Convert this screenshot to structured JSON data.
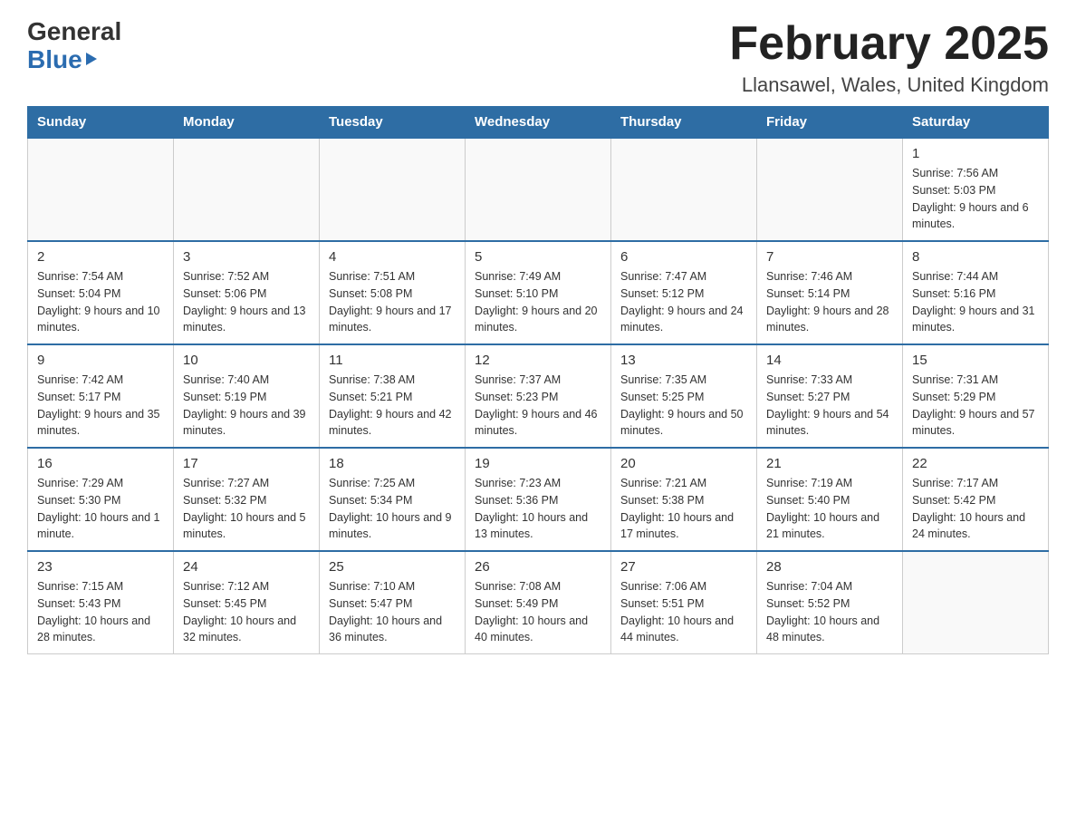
{
  "header": {
    "logo_general": "General",
    "logo_blue": "Blue",
    "month_title": "February 2025",
    "location": "Llansawel, Wales, United Kingdom"
  },
  "weekdays": [
    "Sunday",
    "Monday",
    "Tuesday",
    "Wednesday",
    "Thursday",
    "Friday",
    "Saturday"
  ],
  "weeks": [
    [
      {
        "day": "",
        "info": ""
      },
      {
        "day": "",
        "info": ""
      },
      {
        "day": "",
        "info": ""
      },
      {
        "day": "",
        "info": ""
      },
      {
        "day": "",
        "info": ""
      },
      {
        "day": "",
        "info": ""
      },
      {
        "day": "1",
        "info": "Sunrise: 7:56 AM\nSunset: 5:03 PM\nDaylight: 9 hours and 6 minutes."
      }
    ],
    [
      {
        "day": "2",
        "info": "Sunrise: 7:54 AM\nSunset: 5:04 PM\nDaylight: 9 hours and 10 minutes."
      },
      {
        "day": "3",
        "info": "Sunrise: 7:52 AM\nSunset: 5:06 PM\nDaylight: 9 hours and 13 minutes."
      },
      {
        "day": "4",
        "info": "Sunrise: 7:51 AM\nSunset: 5:08 PM\nDaylight: 9 hours and 17 minutes."
      },
      {
        "day": "5",
        "info": "Sunrise: 7:49 AM\nSunset: 5:10 PM\nDaylight: 9 hours and 20 minutes."
      },
      {
        "day": "6",
        "info": "Sunrise: 7:47 AM\nSunset: 5:12 PM\nDaylight: 9 hours and 24 minutes."
      },
      {
        "day": "7",
        "info": "Sunrise: 7:46 AM\nSunset: 5:14 PM\nDaylight: 9 hours and 28 minutes."
      },
      {
        "day": "8",
        "info": "Sunrise: 7:44 AM\nSunset: 5:16 PM\nDaylight: 9 hours and 31 minutes."
      }
    ],
    [
      {
        "day": "9",
        "info": "Sunrise: 7:42 AM\nSunset: 5:17 PM\nDaylight: 9 hours and 35 minutes."
      },
      {
        "day": "10",
        "info": "Sunrise: 7:40 AM\nSunset: 5:19 PM\nDaylight: 9 hours and 39 minutes."
      },
      {
        "day": "11",
        "info": "Sunrise: 7:38 AM\nSunset: 5:21 PM\nDaylight: 9 hours and 42 minutes."
      },
      {
        "day": "12",
        "info": "Sunrise: 7:37 AM\nSunset: 5:23 PM\nDaylight: 9 hours and 46 minutes."
      },
      {
        "day": "13",
        "info": "Sunrise: 7:35 AM\nSunset: 5:25 PM\nDaylight: 9 hours and 50 minutes."
      },
      {
        "day": "14",
        "info": "Sunrise: 7:33 AM\nSunset: 5:27 PM\nDaylight: 9 hours and 54 minutes."
      },
      {
        "day": "15",
        "info": "Sunrise: 7:31 AM\nSunset: 5:29 PM\nDaylight: 9 hours and 57 minutes."
      }
    ],
    [
      {
        "day": "16",
        "info": "Sunrise: 7:29 AM\nSunset: 5:30 PM\nDaylight: 10 hours and 1 minute."
      },
      {
        "day": "17",
        "info": "Sunrise: 7:27 AM\nSunset: 5:32 PM\nDaylight: 10 hours and 5 minutes."
      },
      {
        "day": "18",
        "info": "Sunrise: 7:25 AM\nSunset: 5:34 PM\nDaylight: 10 hours and 9 minutes."
      },
      {
        "day": "19",
        "info": "Sunrise: 7:23 AM\nSunset: 5:36 PM\nDaylight: 10 hours and 13 minutes."
      },
      {
        "day": "20",
        "info": "Sunrise: 7:21 AM\nSunset: 5:38 PM\nDaylight: 10 hours and 17 minutes."
      },
      {
        "day": "21",
        "info": "Sunrise: 7:19 AM\nSunset: 5:40 PM\nDaylight: 10 hours and 21 minutes."
      },
      {
        "day": "22",
        "info": "Sunrise: 7:17 AM\nSunset: 5:42 PM\nDaylight: 10 hours and 24 minutes."
      }
    ],
    [
      {
        "day": "23",
        "info": "Sunrise: 7:15 AM\nSunset: 5:43 PM\nDaylight: 10 hours and 28 minutes."
      },
      {
        "day": "24",
        "info": "Sunrise: 7:12 AM\nSunset: 5:45 PM\nDaylight: 10 hours and 32 minutes."
      },
      {
        "day": "25",
        "info": "Sunrise: 7:10 AM\nSunset: 5:47 PM\nDaylight: 10 hours and 36 minutes."
      },
      {
        "day": "26",
        "info": "Sunrise: 7:08 AM\nSunset: 5:49 PM\nDaylight: 10 hours and 40 minutes."
      },
      {
        "day": "27",
        "info": "Sunrise: 7:06 AM\nSunset: 5:51 PM\nDaylight: 10 hours and 44 minutes."
      },
      {
        "day": "28",
        "info": "Sunrise: 7:04 AM\nSunset: 5:52 PM\nDaylight: 10 hours and 48 minutes."
      },
      {
        "day": "",
        "info": ""
      }
    ]
  ]
}
